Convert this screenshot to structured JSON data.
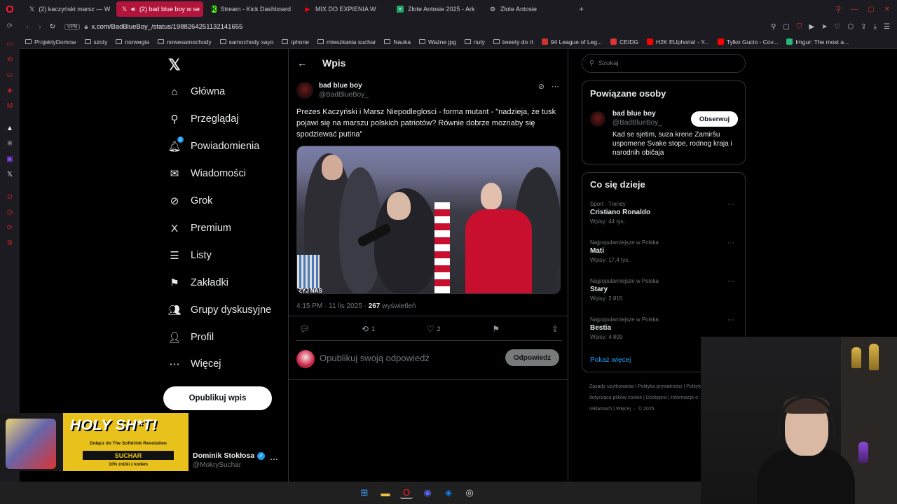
{
  "browser": {
    "tabs": [
      {
        "label": "(2) kaczyński marsz — W",
        "icon": "x-icon",
        "active": false
      },
      {
        "label": "(2) bad blue boy w se",
        "icon": "x-icon",
        "active": true
      },
      {
        "label": "Stream - Kick Dashboard",
        "icon": "kick-icon",
        "active": false
      },
      {
        "label": "MIX DO EXPIENIA W",
        "icon": "youtube-icon",
        "active": false
      },
      {
        "label": "Złote Antosie 2025 - Ark",
        "icon": "sheets-icon",
        "active": false
      },
      {
        "label": "Złote Antosie",
        "icon": "page-icon",
        "active": false
      }
    ],
    "vpn_label": "VPN",
    "url": "x.com/BadBlueBoy_/status/1988264251132141655",
    "bookmarks": [
      "ProjektyDomow",
      "szoty",
      "norwegia",
      "nowesamochody",
      "samochody xayo",
      "iphone",
      "mieszkania suchar",
      "Nauka",
      "Ważne jpg",
      "nuty",
      "tweety do rt",
      "94 League of Leg...",
      "CEIDG",
      "H2K EUphoria! - Y...",
      "Tylko Gucio - Cov...",
      "Imgur: The most a..."
    ]
  },
  "x_nav": {
    "logo": "𝕏",
    "items": [
      {
        "label": "Główna",
        "icon": "home-icon",
        "glyph": "⌂"
      },
      {
        "label": "Przeglądaj",
        "icon": "search-icon",
        "glyph": "⚲"
      },
      {
        "label": "Powiadomienia",
        "icon": "bell-icon",
        "glyph": "🔔︎",
        "badge": "2"
      },
      {
        "label": "Wiadomości",
        "icon": "mail-icon",
        "glyph": "✉"
      },
      {
        "label": "Grok",
        "icon": "grok-icon",
        "glyph": "⊘"
      },
      {
        "label": "Premium",
        "icon": "x-premium-icon",
        "glyph": "X"
      },
      {
        "label": "Listy",
        "icon": "list-icon",
        "glyph": "☰"
      },
      {
        "label": "Zakładki",
        "icon": "bookmark-icon",
        "glyph": "⚑"
      },
      {
        "label": "Grupy dyskusyjne",
        "icon": "community-icon",
        "glyph": "👥︎"
      },
      {
        "label": "Profil",
        "icon": "profile-icon",
        "glyph": "👤︎"
      },
      {
        "label": "Więcej",
        "icon": "more-circle-icon",
        "glyph": "⋯"
      }
    ],
    "post_button": "Opublikuj wpis"
  },
  "main": {
    "title": "Wpis",
    "tweet": {
      "author_name": "bad blue boy",
      "author_handle": "@BadBlueBoy_",
      "text": "Prezes Kaczyński i Marsz Niepodleglosci - forma mutant - \"nadzieja, że tusk pojawi się na marszu polskich patriotów? Równie dobrze moznaby się spodziewać putina\"",
      "time": "4:15 PM · 11 lis 2025 · ",
      "views_count": "267",
      "views_label": " wyświetleń",
      "media_caption": "ZYJ NAS",
      "retweets": "1",
      "likes": "2"
    },
    "reply": {
      "placeholder": "Opublikuj swoją odpowiedź",
      "button": "Odpowiedz"
    }
  },
  "right": {
    "search_placeholder": "Szukaj",
    "related": {
      "title": "Powiązane osoby",
      "name": "bad blue boy",
      "handle": "@BadBlueBoy_",
      "bio": "Kad se sjetim, suza krene Zamiršu uspomene Svake stope, rodnog kraja i narodnih običaja",
      "follow": "Obserwuj"
    },
    "trends": {
      "title": "Co się dzieje",
      "items": [
        {
          "category": "Sport · Trendy",
          "name": "Cristiano Ronaldo",
          "count": "Wpisy: 44 tys."
        },
        {
          "category": "Najpopularniejsze w Polska",
          "name": "Mati",
          "count": "Wpisy: 17,4 tys."
        },
        {
          "category": "Najpopularniejsze w Polska",
          "name": "Stary",
          "count": "Wpisy: 2 815"
        },
        {
          "category": "Najpopularniejsze w Polska",
          "name": "Bestia",
          "count": "Wpisy: 4 809"
        }
      ],
      "show_more": "Pokaż więcej"
    },
    "footer": "Zasady użytkowania | Polityka prywatności | Polityka dotycząca plików cookie | Dostępno | Informacje o reklamach | Więcej ··· © 2025"
  },
  "overlay": {
    "promo_title": "HOLY SH*T!",
    "promo_sub": "Dołącz do The Softdrink Revolution",
    "promo_brand": "SUCHAR",
    "promo_code": "10% zniżki z kodem",
    "user_name": "Dominik Stokłosa",
    "user_handle": "@MokrySuchar"
  },
  "taskbar": [
    "windows-start-icon",
    "file-explorer-icon",
    "opera-icon",
    "discord-icon",
    "messenger-icon",
    "obs-icon"
  ],
  "colors": {
    "accent": "#1d9bf0",
    "active_tab": "#b3143c",
    "opera": "#ff1b2d"
  }
}
